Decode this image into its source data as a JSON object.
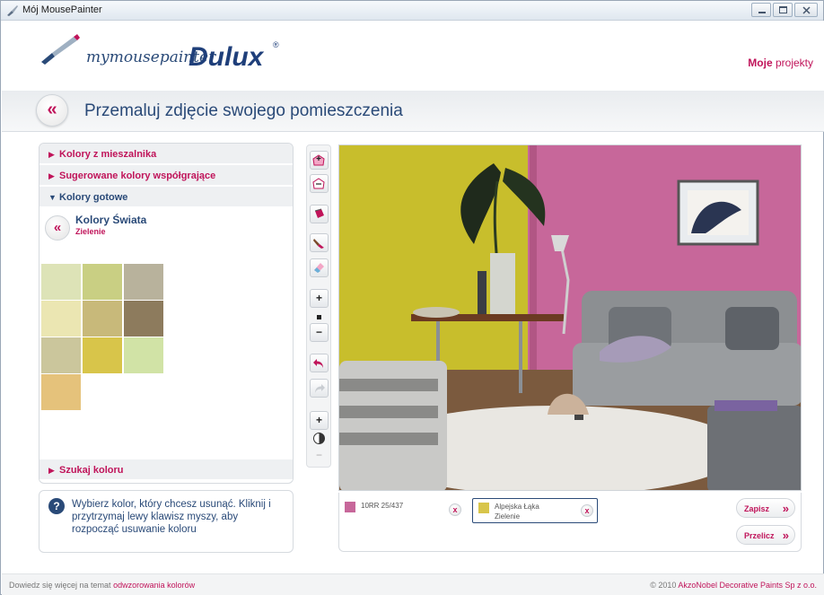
{
  "window": {
    "title": "Mój MousePainter"
  },
  "header": {
    "logo_script": "mymousepainter",
    "logo_brand": "Dulux",
    "projects_bold": "Moje",
    "projects_rest": "projekty"
  },
  "subheader": {
    "back_glyph": "«",
    "title": "Przemaluj zdjęcie swojego pomieszczenia"
  },
  "left_panel": {
    "accordion": [
      {
        "label": "Kolory z mieszalnika",
        "open": false
      },
      {
        "label": "Sugerowane kolory współgrające",
        "open": false
      },
      {
        "label": "Kolory gotowe",
        "open": true
      }
    ],
    "palette": {
      "back_glyph": "«",
      "name": "Kolory Świata",
      "subname": "Zielenie"
    },
    "swatches": [
      "#dde3b7",
      "#c9cf83",
      "#b8b29c",
      "#ebe6b2",
      "#c8b97a",
      "#8d7b5d",
      "#cbc69c",
      "#d8c54a",
      "#d1e3a6",
      "#e5c27b"
    ],
    "search_label": "Szukaj koloru"
  },
  "hint": {
    "icon": "?",
    "text": "Wybierz kolor, który chcesz usunąć. Kliknij i przytrzymaj lewy klawisz myszy, aby rozpocząć usuwanie koloru"
  },
  "toolbar": {
    "zoom_in": "+",
    "zoom_out": "−",
    "contrast_plus": "+",
    "contrast_minus": "−"
  },
  "selected_colors": [
    {
      "code": "10RR 25/437",
      "name": "",
      "family": "",
      "color": "#c7679a",
      "remove": "x"
    },
    {
      "code": "",
      "name": "Alpejska Łąka",
      "family": "Zielenie",
      "color": "#d8c54a",
      "remove": "x"
    }
  ],
  "actions": {
    "save": {
      "label": "Zapisz",
      "go": "»"
    },
    "recalc": {
      "label": "Przelicz",
      "go": "»"
    }
  },
  "footer": {
    "left_prefix": "Dowiedz się więcej na temat",
    "left_link": "odwzorowania kolorów",
    "right_prefix": "© 2010",
    "right_link": "AkzoNobel Decorative Paints Sp z o.o."
  },
  "colors": {
    "accent": "#c0145a",
    "navy": "#2a4a78",
    "wall_left": "#c9c12a",
    "wall_right": "#c7679a"
  }
}
